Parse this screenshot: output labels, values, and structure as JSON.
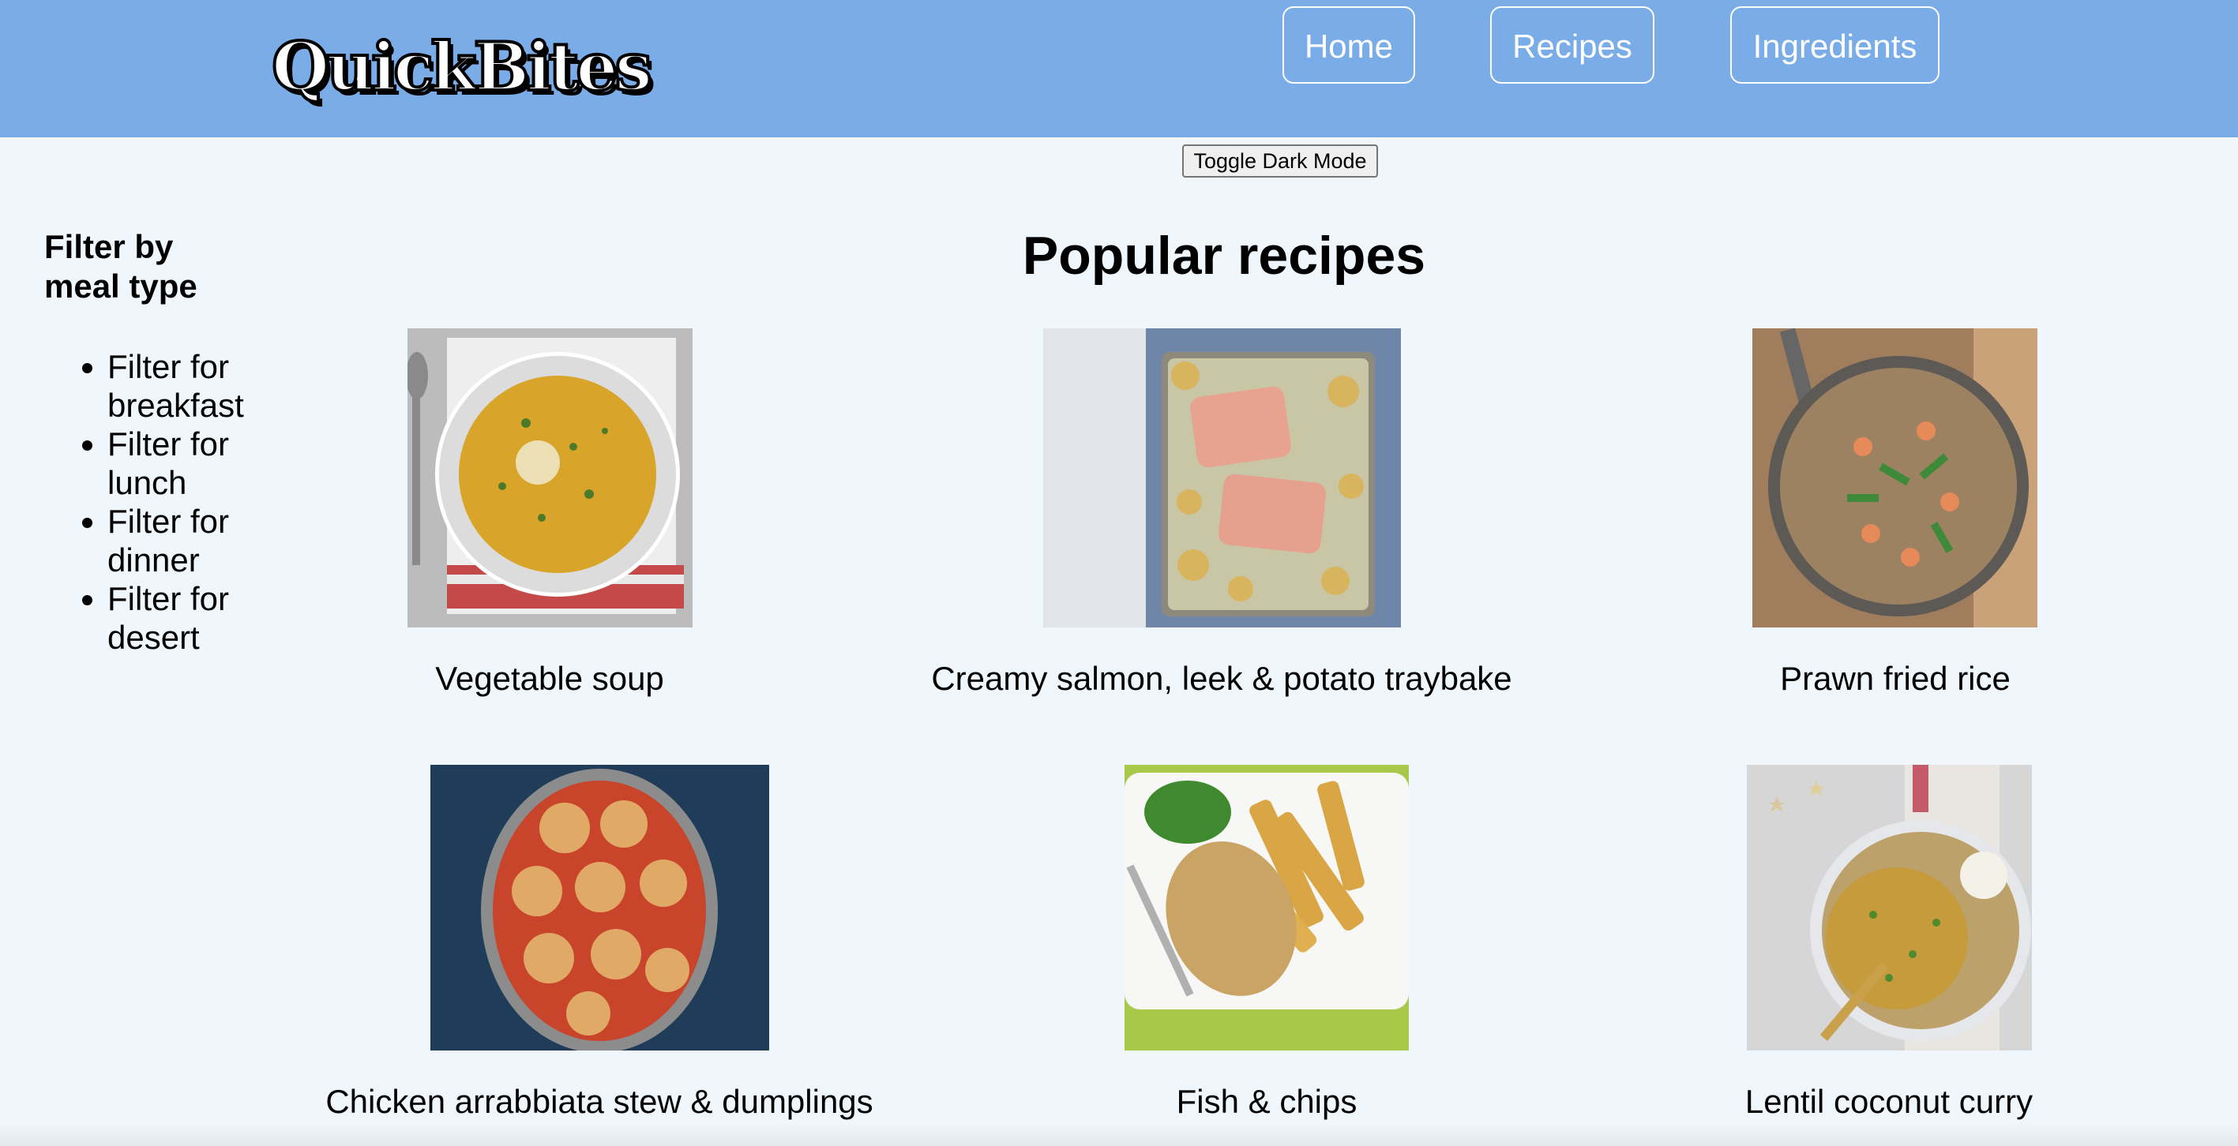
{
  "header": {
    "logo_text": "QuickBites",
    "nav": [
      {
        "label": "Home"
      },
      {
        "label": "Recipes"
      },
      {
        "label": "Ingredients"
      }
    ]
  },
  "toggle_label": "Toggle Dark Mode",
  "sidebar": {
    "title": "Filter by meal type",
    "filters": [
      {
        "label": "Filter for breakfast"
      },
      {
        "label": "Filter for lunch"
      },
      {
        "label": "Filter for dinner"
      },
      {
        "label": "Filter for desert"
      }
    ]
  },
  "main": {
    "title": "Popular recipes",
    "recipes": [
      {
        "name": "Vegetable soup"
      },
      {
        "name": "Creamy salmon, leek & potato traybake"
      },
      {
        "name": "Prawn fried rice"
      },
      {
        "name": "Chicken arrabbiata stew & dumplings"
      },
      {
        "name": "Fish & chips"
      },
      {
        "name": "Lentil coconut curry"
      }
    ]
  }
}
